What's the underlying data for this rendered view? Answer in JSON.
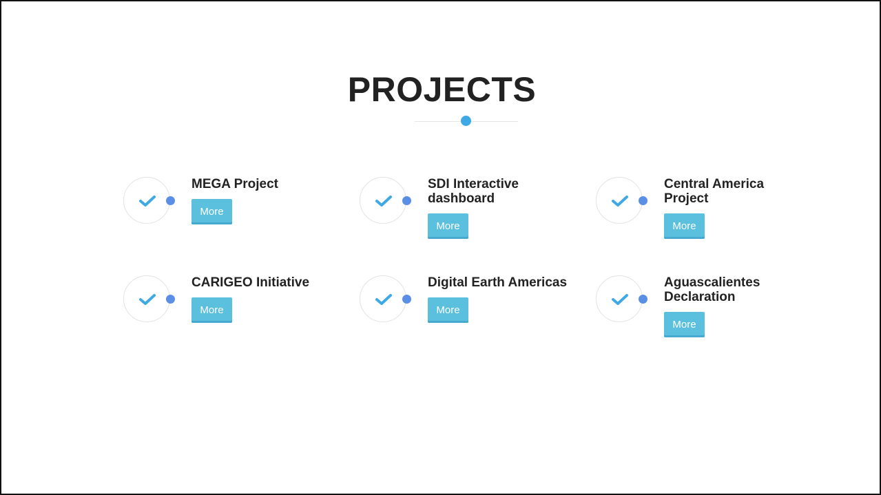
{
  "section": {
    "title": "PROJECTS"
  },
  "colors": {
    "accent": "#3fa9e6",
    "button": "#5bc0de",
    "check": "#3fa9e6",
    "badge_dot": "#5b8fe6",
    "text": "#222222"
  },
  "projects": [
    {
      "title": "MEGA Project",
      "button_label": "More",
      "icon": "check-icon"
    },
    {
      "title": "SDI Interactive dashboard",
      "button_label": "More",
      "icon": "check-icon"
    },
    {
      "title": "Central America Project",
      "button_label": "More",
      "icon": "check-icon"
    },
    {
      "title": "CARIGEO Initiative",
      "button_label": "More",
      "icon": "check-icon"
    },
    {
      "title": "Digital Earth Americas",
      "button_label": "More",
      "icon": "check-icon"
    },
    {
      "title": "Aguascalientes Declaration",
      "button_label": "More",
      "icon": "check-icon"
    }
  ]
}
